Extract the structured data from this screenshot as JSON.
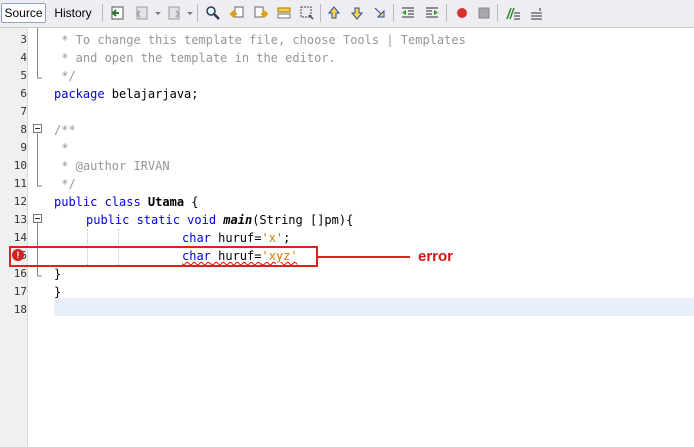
{
  "editor": {
    "tabs": [
      {
        "label": "Source"
      },
      {
        "label": "History"
      }
    ]
  },
  "lines": [
    {
      "num": "3",
      "text": " * To change this template file, choose Tools | Templates"
    },
    {
      "num": "4",
      "text": " * and open the template in the editor."
    },
    {
      "num": "5",
      "text": " */"
    },
    {
      "num": "6",
      "kw": "package",
      "rest": " belajarjava;"
    },
    {
      "num": "7",
      "text": ""
    },
    {
      "num": "8",
      "text": "/**"
    },
    {
      "num": "9",
      "text": " *"
    },
    {
      "num": "10",
      "text": " * @author IRVAN"
    },
    {
      "num": "11",
      "text": " */"
    },
    {
      "num": "12",
      "kw": "public class ",
      "bold": "Utama",
      "rest": " {"
    },
    {
      "num": "13",
      "kw": "public static void ",
      "ital": "main",
      "rest": "(String []pm){"
    },
    {
      "num": "14",
      "kw": "char",
      "rest": " huruf=",
      "str": "'x'",
      "end": ";"
    },
    {
      "num": "15",
      "kw": "char",
      "rest": " huruf=",
      "str": "'xyz'",
      "end": ""
    },
    {
      "num": "16",
      "text": "}"
    },
    {
      "num": "17",
      "text": "}"
    },
    {
      "num": "18",
      "text": ""
    }
  ],
  "annotation": {
    "label": "error",
    "icon_glyph": "!",
    "color": "#e02020"
  },
  "toolbar_icons": [
    "last-edit-icon",
    "back-icon",
    "forward-icon",
    "find-icon",
    "find-previous-icon",
    "find-next-icon",
    "find-selection-icon",
    "toggle-highlight-icon",
    "previous-bookmark-icon",
    "next-bookmark-icon",
    "toggle-bookmark-icon",
    "shift-left-icon",
    "shift-right-icon",
    "start-macro-icon",
    "stop-macro-icon",
    "comment-icon",
    "uncomment-icon"
  ]
}
